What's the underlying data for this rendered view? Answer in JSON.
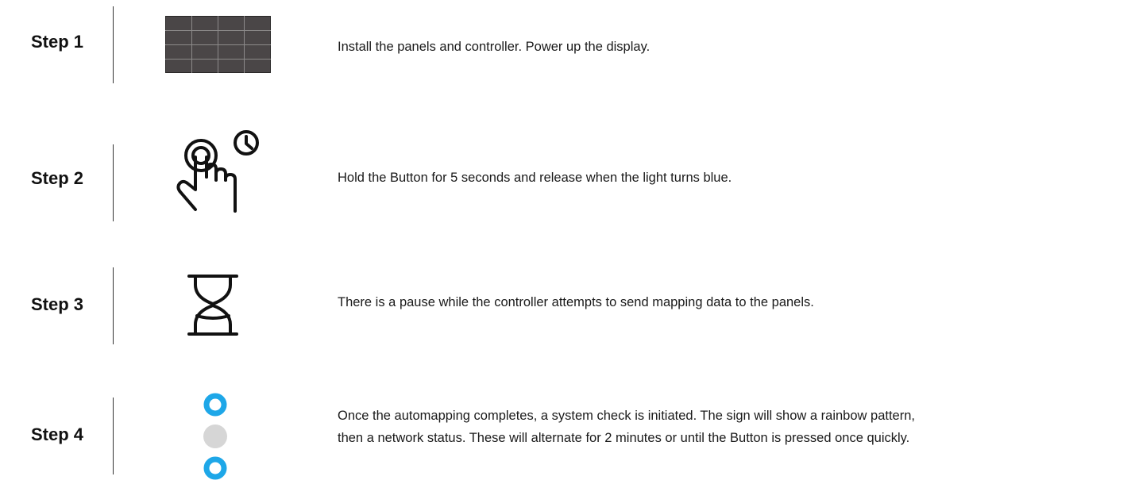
{
  "steps": [
    {
      "label": "Step 1",
      "icon": "led-panel-grid-icon",
      "text": "Install the panels and controller. Power up the display."
    },
    {
      "label": "Step 2",
      "icon": "press-hold-timer-icon",
      "text": "Hold the Button for 5 seconds and release when the light turns blue."
    },
    {
      "label": "Step 3",
      "icon": "hourglass-icon",
      "text": "There is a pause while the controller attempts to send mapping data to the panels."
    },
    {
      "label": "Step 4",
      "icon": "status-lights-icon",
      "text_line1": "Once the automapping completes, a system check is initiated. The sign will show a rainbow pattern,",
      "text_line2": "then a network status. These will alternate for 2 minutes or until the Button is pressed once quickly."
    }
  ],
  "colors": {
    "panel_fill": "#4a4647",
    "light_blue": "#1ea7e8",
    "light_off": "#d6d6d6",
    "line": "#111111"
  }
}
